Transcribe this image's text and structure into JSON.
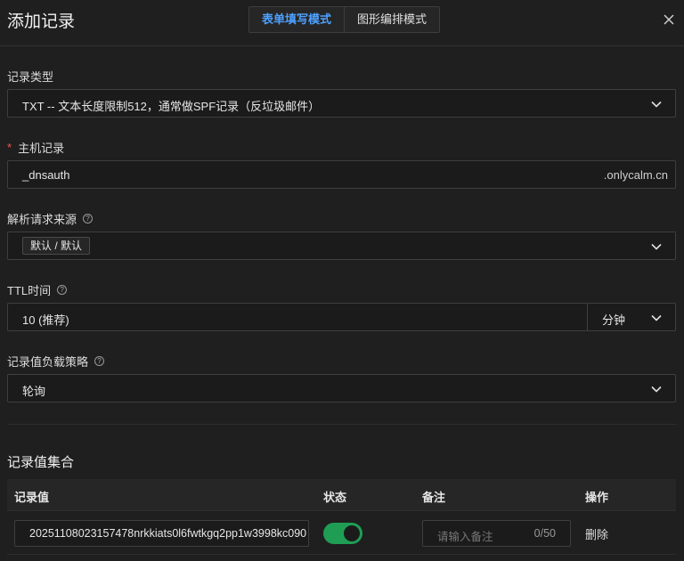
{
  "dialog": {
    "title": "添加记录",
    "modes": [
      "表单填写模式",
      "图形编排模式"
    ]
  },
  "record_type": {
    "label": "记录类型",
    "value": "TXT -- 文本长度限制512，通常做SPF记录（反垃圾邮件）"
  },
  "host": {
    "label": "主机记录",
    "required_mark": "*",
    "value": "_dnsauth",
    "suffix": ".onlycalm.cn"
  },
  "source": {
    "label": "解析请求来源",
    "value": "默认 / 默认"
  },
  "ttl": {
    "label": "TTL时间",
    "value": "10 (推荐)",
    "unit": "分钟"
  },
  "strategy": {
    "label": "记录值负载策略",
    "value": "轮询"
  },
  "records": {
    "title": "记录值集合",
    "columns": [
      "记录值",
      "状态",
      "备注",
      "操作"
    ],
    "rows": [
      {
        "value": "20251108023157478nrkkiats0l6fwtkgq2pp1w3998kc090",
        "enabled": true,
        "note_placeholder": "请输入备注",
        "note_count": "0/50",
        "action": "删除"
      }
    ]
  },
  "icons": {
    "close": "close-icon",
    "help": "question-circle-icon",
    "chevron": "chevron-down-icon"
  },
  "colors": {
    "background": "#1f1f1f",
    "accent": "#4da1ff",
    "toggle_on": "#1f9d55",
    "required": "#ff5050"
  }
}
